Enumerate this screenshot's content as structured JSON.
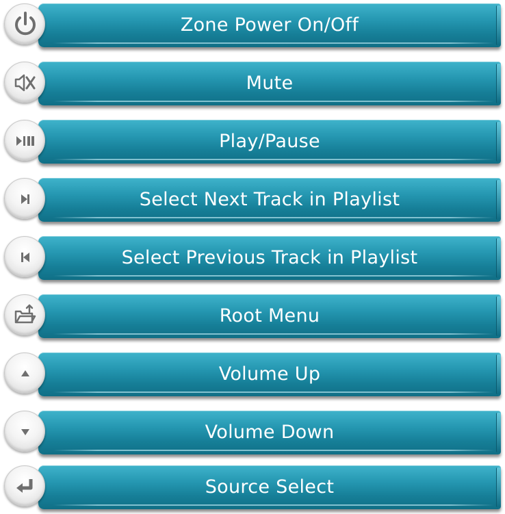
{
  "buttons": [
    {
      "label": "Zone Power On/Off",
      "icon": "power-icon"
    },
    {
      "label": "Mute",
      "icon": "mute-icon"
    },
    {
      "label": "Play/Pause",
      "icon": "play-pause-icon"
    },
    {
      "label": "Select Next Track in Playlist",
      "icon": "next-track-icon"
    },
    {
      "label": "Select Previous Track in Playlist",
      "icon": "previous-track-icon"
    },
    {
      "label": "Root Menu",
      "icon": "root-menu-icon"
    },
    {
      "label": "Volume Up",
      "icon": "volume-up-icon"
    },
    {
      "label": "Volume Down",
      "icon": "volume-down-icon"
    },
    {
      "label": "Source Select",
      "icon": "source-select-icon"
    }
  ],
  "colors": {
    "bar_top": "#3fb3cb",
    "bar_bottom": "#106f86",
    "icon_gray": "#6f6f6f",
    "text": "#ffffff"
  }
}
